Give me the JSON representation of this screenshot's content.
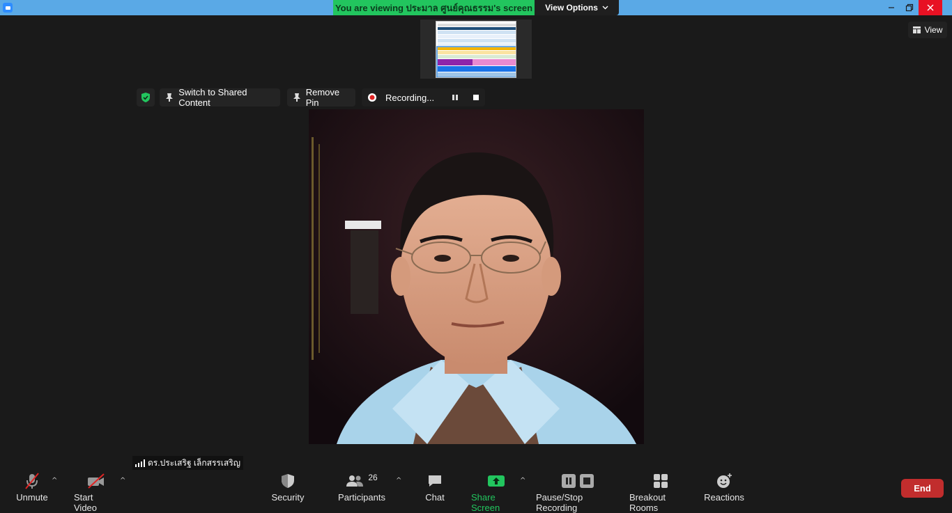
{
  "banner": {
    "viewing_text": "You are viewing ประมาล ศูนย์คุณธรรม's screen",
    "view_options_label": "View Options"
  },
  "top_right": {
    "view_label": "View"
  },
  "pinned_toolbar": {
    "switch_label": "Switch to Shared Content",
    "remove_pin_label": "Remove Pin",
    "recording_label": "Recording..."
  },
  "participant": {
    "name": "ดร.ประเสริฐ เล็กสรรเสริญ"
  },
  "toolbar": {
    "unmute_label": "Unmute",
    "start_video_label": "Start Video",
    "security_label": "Security",
    "participants_label": "Participants",
    "participants_count": "26",
    "chat_label": "Chat",
    "share_screen_label": "Share Screen",
    "pause_stop_label": "Pause/Stop Recording",
    "breakout_label": "Breakout Rooms",
    "reactions_label": "Reactions",
    "end_label": "End"
  },
  "colors": {
    "accent_green": "#22c55e",
    "end_red": "#c12d2d",
    "titlebar_blue": "#5aa9e6"
  }
}
